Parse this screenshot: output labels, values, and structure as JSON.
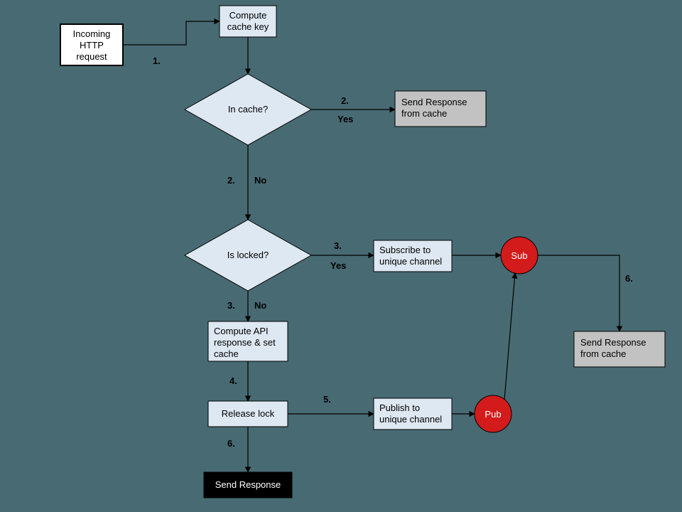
{
  "nodes": {
    "start": "Incoming\nHTTP\nrequest",
    "compute_key": "Compute\ncache key",
    "in_cache": "In cache?",
    "resp_cache_1": "Send Response\nfrom cache",
    "is_locked": "Is locked?",
    "subscribe": "Subscribe to\nunique channel",
    "sub": "Sub",
    "compute_api": "Compute API\nresponse & set\ncache",
    "release": "Release lock",
    "publish": "Publish to\nunique channel",
    "pub": "Pub",
    "resp_cache_2": "Send Response\nfrom cache",
    "send_resp": "Send Response"
  },
  "labels": {
    "n1": "1.",
    "n2a": "2.",
    "a2a": "Yes",
    "n2b": "2.",
    "a2b": "No",
    "n3a": "3.",
    "a3a": "Yes",
    "n3b": "3.",
    "a3b": "No",
    "n4": "4.",
    "n5": "5.",
    "n6a": "6.",
    "n6b": "6."
  }
}
